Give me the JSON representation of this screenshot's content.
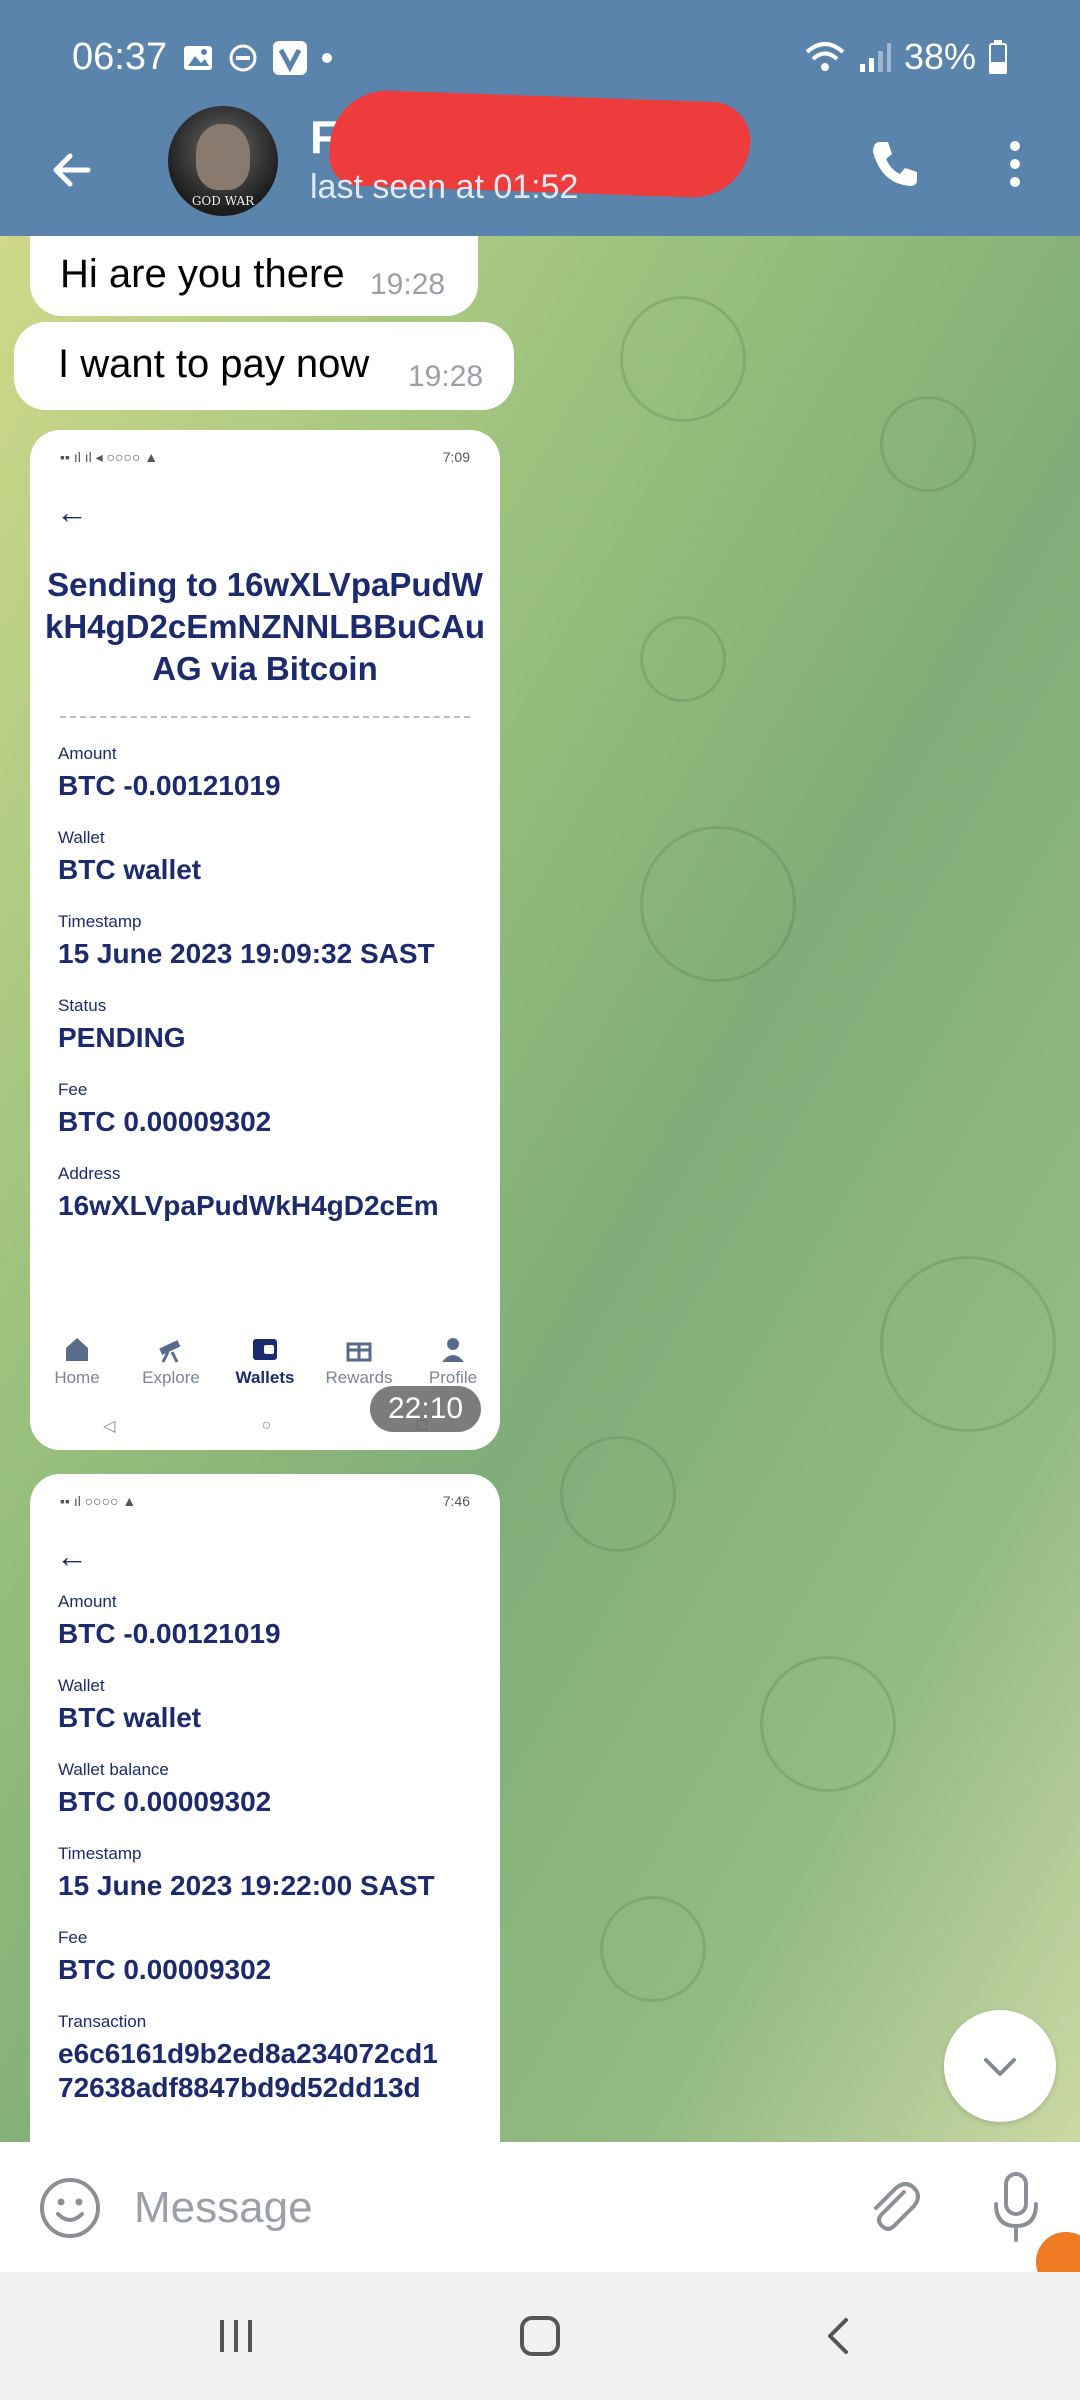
{
  "status_bar": {
    "time": "06:37",
    "battery": "38%"
  },
  "header": {
    "contact_name": "F",
    "last_seen": "last seen at 01:52",
    "avatar_text": "GOD WAR"
  },
  "messages": [
    {
      "text": "Hi are you there",
      "time": "19:28"
    },
    {
      "text": "I want to pay now",
      "time": "19:28"
    }
  ],
  "screenshot1": {
    "status_time": "7:09",
    "title": "Sending to 16wXLVpaPudWkH4gD2cEmNZNNLBBuCAuAG via Bitcoin",
    "fields": [
      {
        "label": "Amount",
        "value": "BTC -0.00121019"
      },
      {
        "label": "Wallet",
        "value": "BTC wallet"
      },
      {
        "label": "Timestamp",
        "value": "15 June 2023 19:09:32 SAST"
      },
      {
        "label": "Status",
        "value": "PENDING"
      },
      {
        "label": "Fee",
        "value": "BTC 0.00009302"
      },
      {
        "label": "Address",
        "value": "16wXLVpaPudWkH4gD2cEm"
      }
    ],
    "nav": [
      {
        "label": "Home",
        "icon": "home-icon"
      },
      {
        "label": "Explore",
        "icon": "telescope-icon"
      },
      {
        "label": "Wallets",
        "icon": "wallet-icon"
      },
      {
        "label": "Rewards",
        "icon": "gift-icon"
      },
      {
        "label": "Profile",
        "icon": "person-icon"
      }
    ],
    "time_badge": "22:10"
  },
  "screenshot2": {
    "status_time": "7:46",
    "fields": [
      {
        "label": "Amount",
        "value": "BTC -0.00121019"
      },
      {
        "label": "Wallet",
        "value": "BTC wallet"
      },
      {
        "label": "Wallet balance",
        "value": "BTC 0.00009302"
      },
      {
        "label": "Timestamp",
        "value": "15 June 2023 19:22:00 SAST"
      },
      {
        "label": "Fee",
        "value": "BTC 0.00009302"
      },
      {
        "label": "Transaction",
        "value": "e6c6161d9b2ed8a234072cd1"
      },
      {
        "label": "",
        "value": "72638adf8847bd9d52dd13d"
      }
    ]
  },
  "input": {
    "placeholder": "Message"
  },
  "colors": {
    "header": "#5a84ac",
    "app_text": "#1d2a6e"
  }
}
